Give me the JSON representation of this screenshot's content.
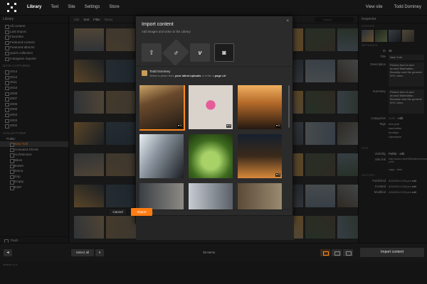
{
  "topbar": {
    "nav": [
      "Library",
      "Text",
      "Site",
      "Settings",
      "Store"
    ],
    "right": [
      "View site",
      "Todd Dominey"
    ]
  },
  "sidebar": {
    "title": "Library",
    "items": [
      "All content",
      "Last import",
      "Favorites",
      "Featured content",
      "Featured albums",
      "Quick collection",
      "Instagram imports"
    ],
    "date_section": "DATE CAPTURED",
    "years": [
      "2014",
      "2012",
      "2011",
      "2010",
      "2008",
      "2007",
      "2006",
      "2005",
      "2004",
      "2003",
      "2002"
    ],
    "collections_section": "COLLECTIONS",
    "collection_group": "Public",
    "collections": [
      "New York",
      "Animated Shorts",
      "Architecture",
      "Bikes",
      "Bokeh",
      "Demo",
      "Grip",
      "Empty",
      "ESIP"
    ],
    "trash": "Trash"
  },
  "toolbar": {
    "items": [
      "Edit",
      "Sort",
      "Filter",
      "Reset"
    ],
    "search_placeholder": "Search"
  },
  "inspector": {
    "title": "Inspector",
    "sections": {
      "covers": "COVERS",
      "metadata": "METADATA",
      "site": "SITE",
      "history": "HISTORY"
    },
    "id_label": "ID",
    "id_value": "36",
    "title_label": "Title",
    "title_value": "New York",
    "description_label": "Description",
    "description_value": "Photos from in and around Manhattan, Brooklyn and the general NYC area.",
    "summary_label": "Summary",
    "summary_value": "Photos from in and around Manhattan, Brooklyn and the general NYC area.",
    "categories_label": "Categories",
    "categories_value": "none",
    "edit": "edit",
    "tags_label": "Tags",
    "tags": [
      "new york",
      "manhattan",
      "brooklyn",
      "cityscapes"
    ],
    "visibility_label": "Visibility",
    "visibility_value": "Public",
    "sitelink_label": "Site link",
    "sitelink_value": "http://koken.dev/2680/albums/new-york/",
    "copy": "copy",
    "view": "view",
    "published_label": "Published",
    "published_value": "4/14/2014 2:54 pm",
    "created_label": "Created",
    "created_value": "4/14/2014 2:54 pm",
    "modified_label": "Modified",
    "modified_value": "4/14/2014 2:54 pm"
  },
  "bottombar": {
    "back": "◂",
    "select_all": "Select all",
    "count": "35 Items",
    "import": "Import content"
  },
  "status": "Version x.x.x",
  "modal": {
    "title": "Import content",
    "subtitle": "Add images and video to the Library",
    "close": "×",
    "sources": [
      {
        "name": "upload",
        "glyph": "⇪"
      },
      {
        "name": "link",
        "glyph": "∞"
      },
      {
        "name": "vimeo",
        "glyph": "v"
      },
      {
        "name": "instagram",
        "glyph": "◙"
      }
    ],
    "account_name": "Todd Dominey",
    "hint_pre": "Select a photo from ",
    "hint_bold1": "your latest uploads",
    "hint_mid": " or enter a ",
    "hint_bold2": "page url",
    "options": "OPTIONS",
    "cancel": "Cancel",
    "import": "Import",
    "badges": [
      "♥ 3",
      "♥ 4",
      "♥ 0",
      "",
      "",
      "♥ 3",
      "",
      "",
      ""
    ]
  },
  "colors": {
    "accent": "#ff7d13",
    "background": "#1d1d1d"
  }
}
